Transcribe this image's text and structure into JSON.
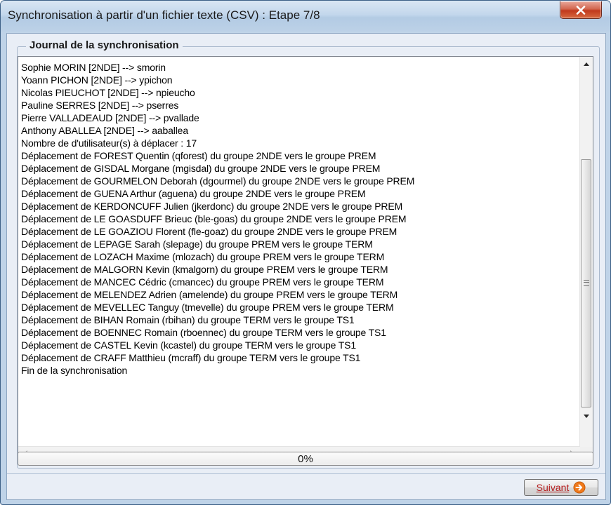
{
  "window": {
    "title": "Synchronisation à partir d'un fichier texte (CSV) : Etape 7/8",
    "close_icon": "close-icon"
  },
  "journal": {
    "legend": "Journal de la synchronisation",
    "lines": [
      "Sophie MORIN [2NDE] --> smorin",
      "Yoann PICHON [2NDE] --> ypichon",
      "Nicolas PIEUCHOT [2NDE] --> npieucho",
      "Pauline SERRES [2NDE] --> pserres",
      "Pierre VALLADEAUD [2NDE] --> pvallade",
      "Anthony ABALLEA [2NDE] --> aaballea",
      "Nombre de d'utilisateur(s) à déplacer : 17",
      "Déplacement de FOREST Quentin (qforest) du groupe 2NDE vers le groupe PREM",
      "Déplacement de GISDAL Morgane (mgisdal) du groupe 2NDE vers le groupe PREM",
      "Déplacement de GOURMELON Deborah (dgourmel) du groupe 2NDE vers le groupe PREM",
      "Déplacement de GUENA Arthur (aguena) du groupe 2NDE vers le groupe PREM",
      "Déplacement de KERDONCUFF Julien (jkerdonc) du groupe 2NDE vers le groupe PREM",
      "Déplacement de LE GOASDUFF Brieuc (ble-goas) du groupe 2NDE vers le groupe PREM",
      "Déplacement de LE GOAZIOU Florent (fle-goaz) du groupe 2NDE vers le groupe PREM",
      "Déplacement de LEPAGE Sarah (slepage) du groupe PREM vers le groupe TERM",
      "Déplacement de LOZACH Maxime (mlozach) du groupe PREM vers le groupe TERM",
      "Déplacement de MALGORN Kevin (kmalgorn) du groupe PREM vers le groupe TERM",
      "Déplacement de MANCEC Cédric (cmancec) du groupe PREM vers le groupe TERM",
      "Déplacement de MELENDEZ Adrien (amelende) du groupe PREM vers le groupe TERM",
      "Déplacement de MEVELLEC Tanguy (tmevelle) du groupe PREM vers le groupe TERM",
      "Déplacement de BIHAN Romain (rbihan) du groupe TERM vers le groupe TS1",
      "Déplacement de BOENNEC Romain (rboennec) du groupe TERM vers le groupe TS1",
      "Déplacement de CASTEL Kevin (kcastel) du groupe TERM vers le groupe TS1",
      "Déplacement de CRAFF Matthieu (mcraff) du groupe TERM vers le groupe TS1",
      "Fin de la synchronisation"
    ]
  },
  "progress": {
    "label": "0%",
    "value_fraction": 0.0
  },
  "footer": {
    "next_label": "Suivant",
    "next_icon": "arrow-right-circle-icon"
  },
  "colors": {
    "progress_fill": "#41b343",
    "next_label": "#b51d1d",
    "next_icon": "#f07a1c"
  }
}
